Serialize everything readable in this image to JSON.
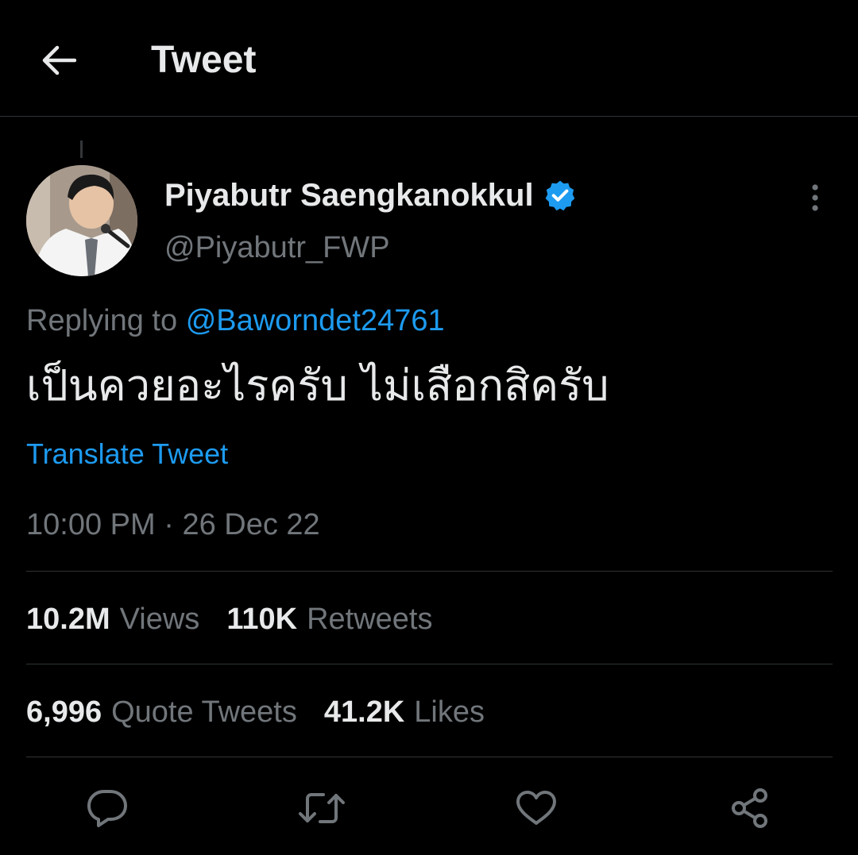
{
  "header": {
    "title": "Tweet",
    "back_icon": "arrow-left-icon"
  },
  "author": {
    "display_name": "Piyabutr Saengkanokkul",
    "handle": "@Piyabutr_FWP",
    "verified": true,
    "verified_color": "#1d9bf0"
  },
  "tweet": {
    "replying_prefix": "Replying to",
    "replying_to": "@Baworndet24761",
    "text": "เป็นควยอะไรครับ ไม่เสือกสิครับ",
    "translate_label": "Translate Tweet",
    "time": "10:00 PM",
    "separator": "·",
    "date": "26 Dec 22"
  },
  "stats": {
    "views_count": "10.2M",
    "views_label": "Views",
    "retweets_count": "110K",
    "retweets_label": "Retweets",
    "quotes_count": "6,996",
    "quotes_label": "Quote Tweets",
    "likes_count": "41.2K",
    "likes_label": "Likes"
  },
  "actions": {
    "reply_icon": "reply-icon",
    "retweet_icon": "retweet-icon",
    "like_icon": "heart-icon",
    "share_icon": "share-icon"
  },
  "colors": {
    "background": "#000000",
    "text_primary": "#e7e9ea",
    "text_secondary": "#71767b",
    "accent": "#1d9bf0",
    "divider": "#2f3336"
  }
}
